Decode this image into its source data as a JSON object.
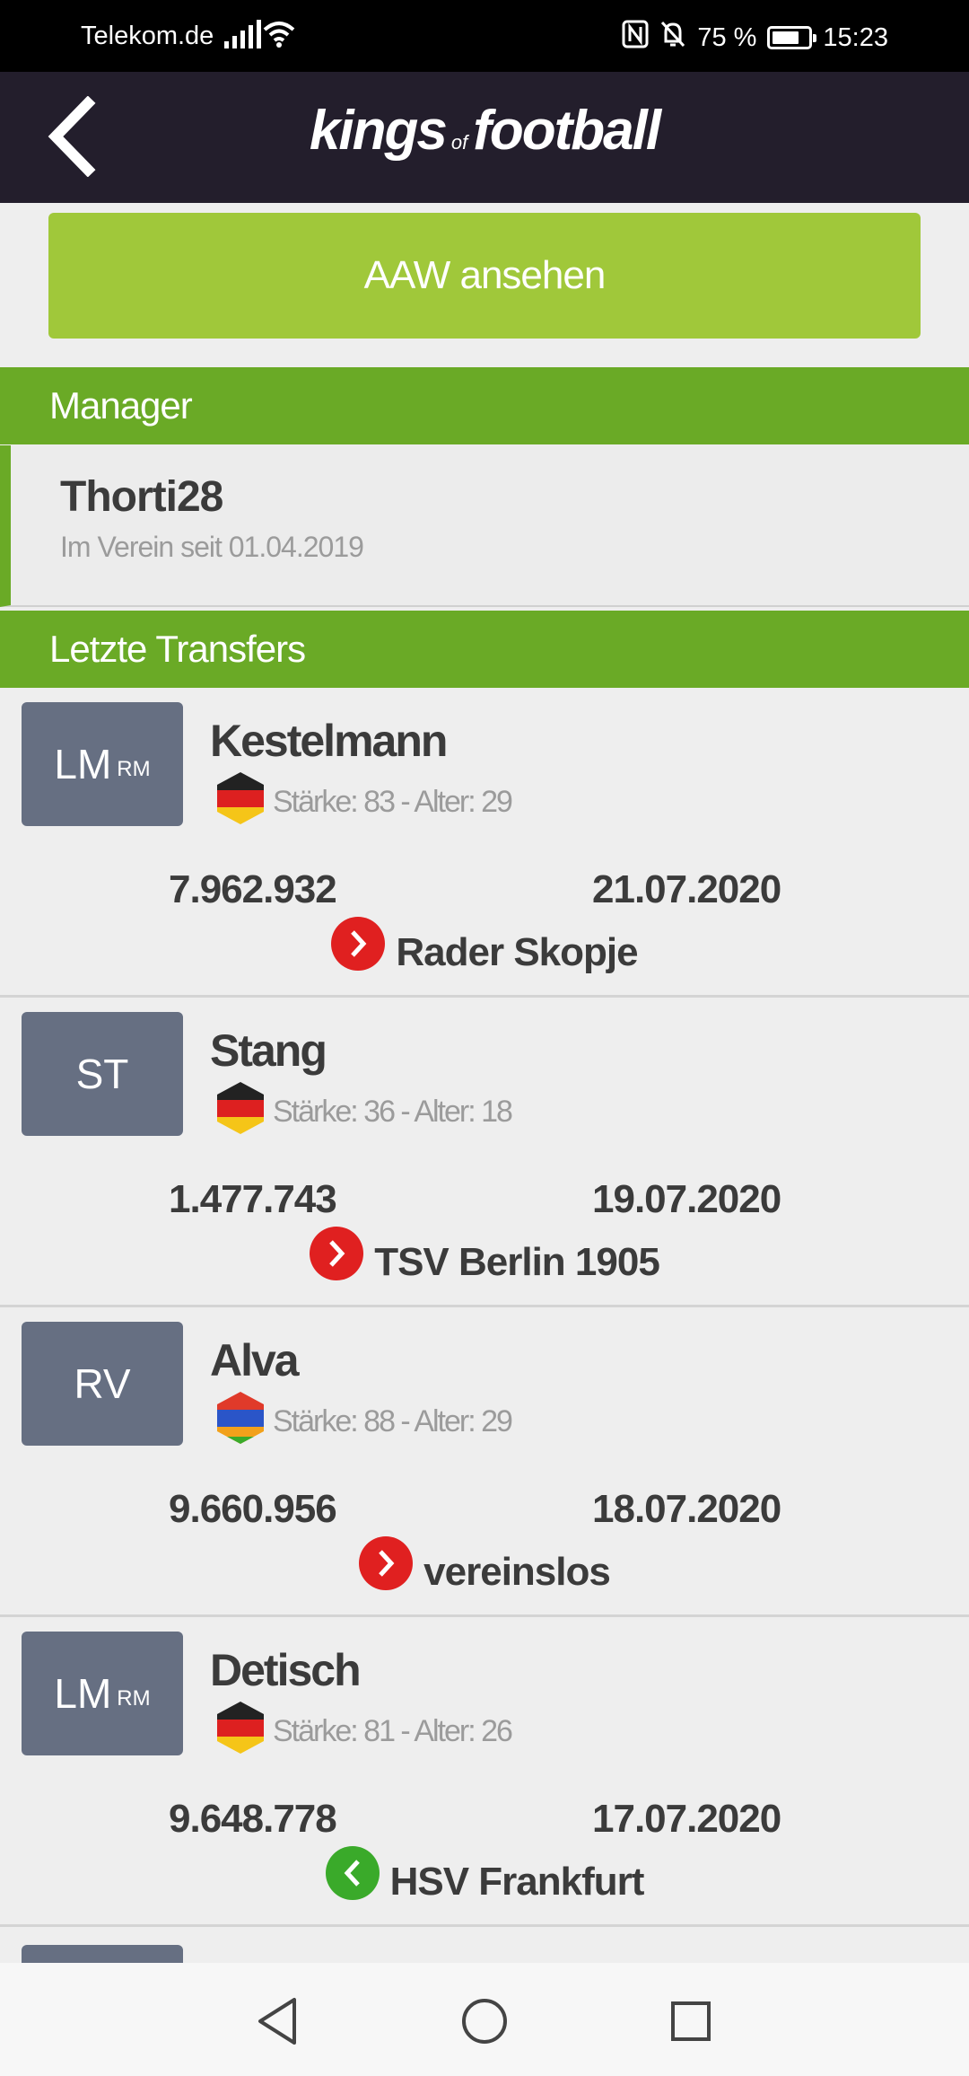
{
  "status_bar": {
    "carrier": "Telekom.de",
    "battery": "75 %",
    "battery_level": 0.75,
    "time": "15:23",
    "icons": [
      "signal-icon",
      "wifi-icon",
      "nfc-icon",
      "bell-off-icon",
      "battery-icon"
    ]
  },
  "app_bar": {
    "logo_part1": "kings",
    "logo_part2": "of",
    "logo_part3": "football",
    "back_icon": "chevron-left-icon"
  },
  "cta": {
    "label": "AAW ansehen",
    "color": "#a0c83a"
  },
  "sections": {
    "manager_title": "Manager",
    "transfers_title": "Letzte Transfers",
    "header_color": "#6aaa26"
  },
  "manager": {
    "name": "Thorti28",
    "since": "Im Verein seit 01.04.2019"
  },
  "transfers": [
    {
      "pos": "LM",
      "pos_sub": "RM",
      "name": "Kestelmann",
      "flag": "germany-flag",
      "stats": "Stärke: 83 - Alter: 29",
      "fee": "7.962.932",
      "date": "21.07.2020",
      "direction": "out",
      "club": "Rader Skopje"
    },
    {
      "pos": "ST",
      "pos_sub": "",
      "name": "Stang",
      "flag": "germany-flag",
      "stats": "Stärke: 36 - Alter: 18",
      "fee": "1.477.743",
      "date": "19.07.2020",
      "direction": "out",
      "club": "TSV Berlin 1905"
    },
    {
      "pos": "RV",
      "pos_sub": "",
      "name": "Alva",
      "flag": "armenia-flag",
      "stats": "Stärke: 88 - Alter: 29",
      "fee": "9.660.956",
      "date": "18.07.2020",
      "direction": "out",
      "club": "vereinslos"
    },
    {
      "pos": "LM",
      "pos_sub": "RM",
      "name": "Detisch",
      "flag": "germany-flag",
      "stats": "Stärke: 81 - Alter: 26",
      "fee": "9.648.778",
      "date": "17.07.2020",
      "direction": "in",
      "club": "HSV Frankfurt"
    }
  ],
  "nav_bar": {
    "icons": [
      "back-triangle-icon",
      "home-circle-icon",
      "recents-square-icon"
    ]
  }
}
